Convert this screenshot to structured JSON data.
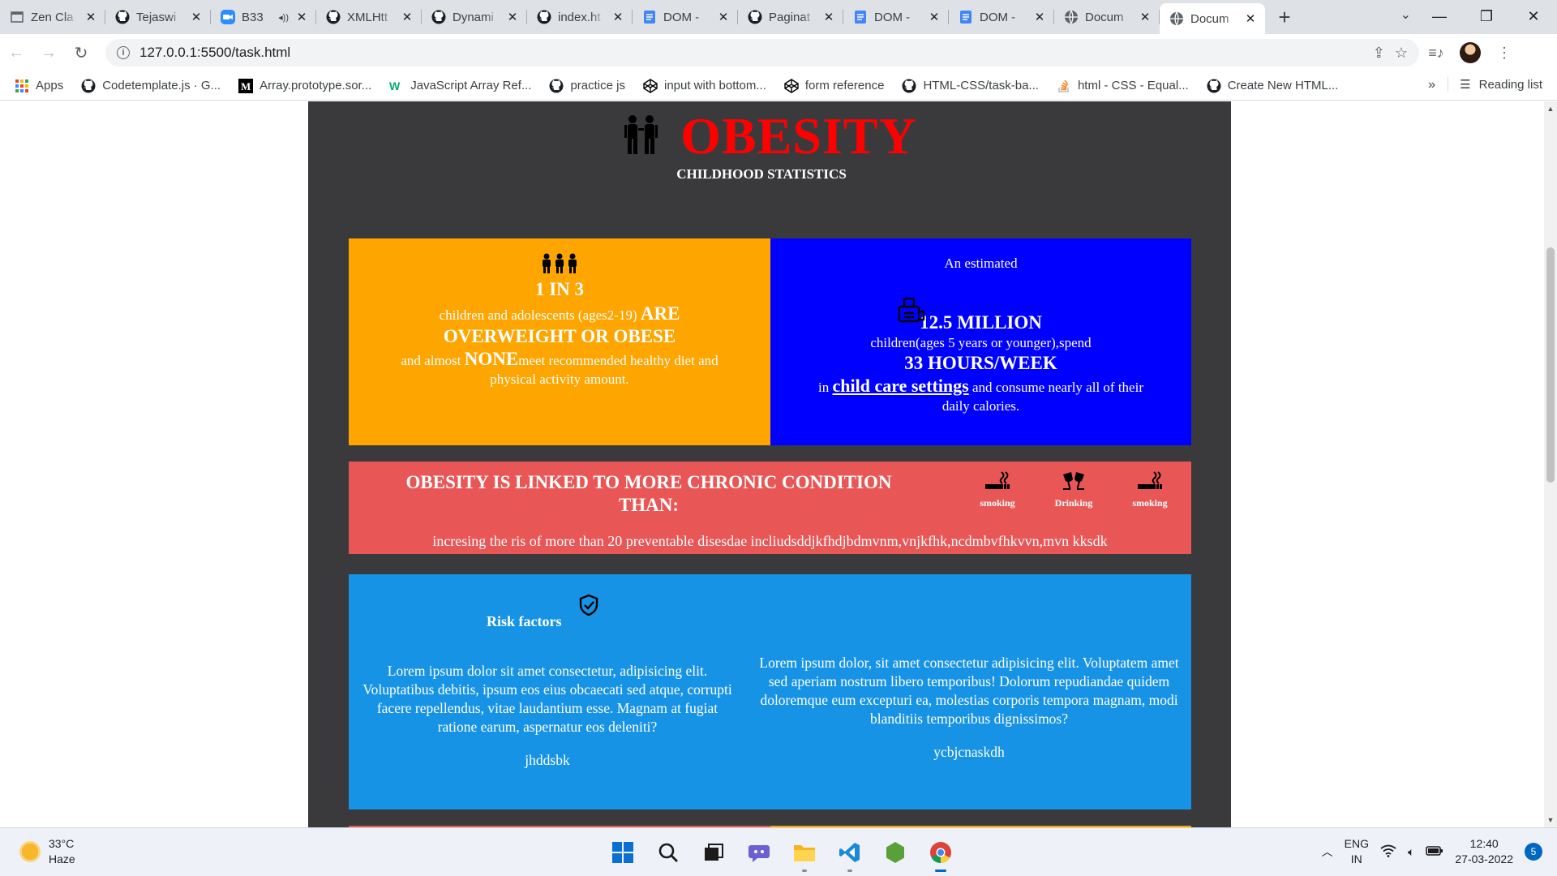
{
  "browser": {
    "tabs": [
      {
        "title": "Zen Cla",
        "icon": "window-icon"
      },
      {
        "title": "Tejaswi",
        "icon": "github-icon"
      },
      {
        "title": "B33",
        "icon": "zoom-icon",
        "audio": "◂))"
      },
      {
        "title": "XMLHtt",
        "icon": "github-icon"
      },
      {
        "title": "Dynami",
        "icon": "github-icon"
      },
      {
        "title": "index.ht",
        "icon": "github-icon"
      },
      {
        "title": "DOM -",
        "icon": "docs-icon"
      },
      {
        "title": "Paginat",
        "icon": "github-icon"
      },
      {
        "title": "DOM -",
        "icon": "docs-icon"
      },
      {
        "title": "DOM -",
        "icon": "docs-icon"
      },
      {
        "title": "Docum",
        "icon": "globe-icon"
      },
      {
        "title": "Docum",
        "icon": "globe-icon",
        "active": true
      }
    ],
    "new_tab": "+",
    "url": "127.0.0.1:5500/task.html",
    "bookmarks": [
      {
        "label": "Apps",
        "icon": "apps-grid-icon"
      },
      {
        "label": "Codetemplate.js · G...",
        "icon": "github-icon"
      },
      {
        "label": "Array.prototype.sor...",
        "icon": "medium-icon"
      },
      {
        "label": "JavaScript Array Ref...",
        "icon": "w3schools-icon"
      },
      {
        "label": "practice js",
        "icon": "github-icon"
      },
      {
        "label": "input with bottom...",
        "icon": "codepen-icon"
      },
      {
        "label": "form reference",
        "icon": "codepen-icon"
      },
      {
        "label": "HTML-CSS/task-ba...",
        "icon": "github-icon"
      },
      {
        "label": "html - CSS - Equal...",
        "icon": "stackoverflow-icon"
      },
      {
        "label": "Create New HTML...",
        "icon": "github-icon"
      }
    ],
    "bookmarks_more": "»",
    "reading_list": "Reading list"
  },
  "page": {
    "title": "OBESITY",
    "subtitle": "CHILDHOOD STATISTICS",
    "card_orange": {
      "stat": "1 IN 3",
      "line1": "children and adolescents (ages2-19)",
      "emph1": "ARE",
      "emph2": "OVERWEIGHT OR OBESE",
      "line2a": "and almost",
      "emph3": "NONE",
      "line2b": "meet recommended healthy diet and",
      "line3": "physical activity amount."
    },
    "card_blue": {
      "intro": "An estimated",
      "stat": "12.5 MILLION",
      "line1": "children(ages 5 years or younger),spend",
      "stat2": "33 HOURS/WEEK",
      "line2a": "in",
      "link": "child care settings",
      "line2b": "and consume nearly all of their",
      "line3": "daily calories."
    },
    "card_red": {
      "heading": "OBESITY IS LINKED TO MORE CHRONIC CONDITION THAN:",
      "icons": [
        {
          "label": "smoking",
          "icon": "smoking-icon"
        },
        {
          "label": "Drinking",
          "icon": "drinking-glasses-icon"
        },
        {
          "label": "smoking",
          "icon": "smoking-icon"
        }
      ],
      "body": "incresing the ris of more than 20 preventable disesdae incliudsddjkfhdjbdmvnm,vnjkfhk,ncdmbvfhkvvn,mvn kksdk"
    },
    "card_risk": {
      "title": "Risk factors",
      "left_text": "Lorem ipsum dolor sit amet consectetur, adipisicing elit. Voluptatibus debitis, ipsum eos eius obcaecati sed atque, corrupti facere repellendus, vitae laudantium esse. Magnam at fugiat ratione earum, aspernatur eos deleniti?",
      "left_extra": "jhddsbk",
      "right_text": "Lorem ipsum dolor, sit amet consectetur adipisicing elit. Voluptatem amet sed aperiam nostrum libero temporibus! Dolorum repudiandae quidem doloremque eum excepturi ea, molestias corporis tempora magnam, modi blanditiis temporibus dignissimos?",
      "right_extra": "ycbjcnaskdh"
    }
  },
  "taskbar": {
    "weather_temp": "33°C",
    "weather_desc": "Haze",
    "lang1": "ENG",
    "lang2": "IN",
    "time": "12:40",
    "date": "27-03-2022",
    "notifications": "5"
  },
  "colors": {
    "page_bg": "#3a3a3c",
    "title_red": "#ff0000",
    "orange": "#ffa500",
    "blue": "#0000ff",
    "red_card": "#e85656",
    "sky": "#1793e6"
  }
}
